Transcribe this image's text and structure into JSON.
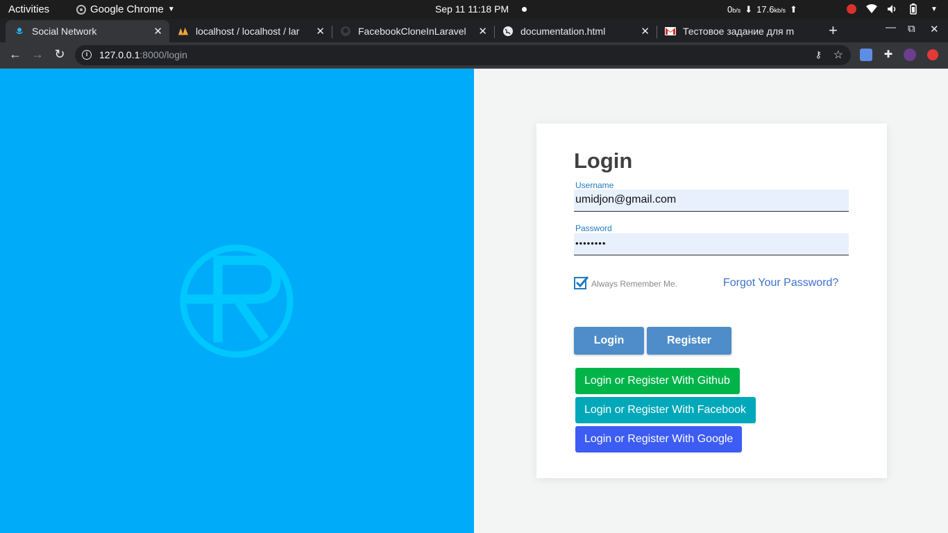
{
  "os_bar": {
    "activities": "Activities",
    "app_name": "Google Chrome",
    "datetime": "Sep 11  11:18 PM",
    "net_down_value": "0",
    "net_down_unit": "b/s",
    "net_up_value": "17.6",
    "net_up_unit": "kb/s"
  },
  "tabs": [
    {
      "title": "Social Network"
    },
    {
      "title": "localhost / localhost / lar"
    },
    {
      "title": "FacebookCloneInLaravel"
    },
    {
      "title": "documentation.html"
    },
    {
      "title": "Тестовое задание для m"
    }
  ],
  "window_controls": {
    "new_tab": "+",
    "minimize": "—",
    "maximize": "⧉",
    "close": "✕"
  },
  "address_bar": {
    "host": "127.0.0.1",
    "path": ":8000/login"
  },
  "colors": {
    "left_panel": "#00acf9",
    "logo": "#00c8ff",
    "primary_button": "#4e8dca",
    "github_button": "#00b449",
    "facebook_button": "#00a8b9",
    "google_button": "#3c5cf4"
  },
  "login_form": {
    "title": "Login",
    "username_label": "Username",
    "username_value": "umidjon@gmail.com",
    "password_label": "Password",
    "password_value": "••••••••",
    "remember_label": "Always Remember Me.",
    "remember_checked": true,
    "forgot_link": "Forgot Your Password?",
    "login_button": "Login",
    "register_button": "Register",
    "github_button": "Login or Register With Github",
    "facebook_button": "Login or Register With Facebook",
    "google_button": "Login or Register With Google"
  }
}
